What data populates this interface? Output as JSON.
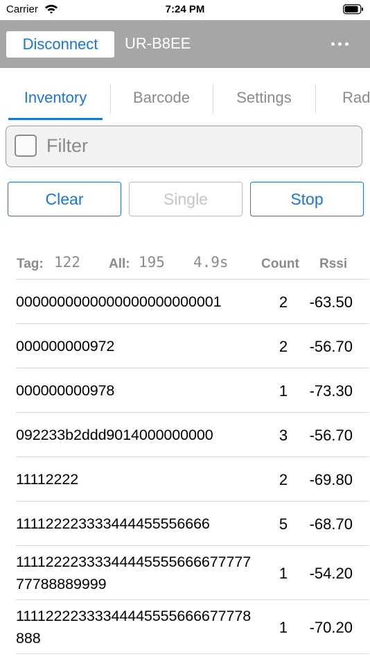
{
  "status_bar": {
    "carrier": "Carrier",
    "time": "7:24 PM"
  },
  "header": {
    "disconnect_label": "Disconnect",
    "device_name": "UR-B8EE",
    "more_icon": "ellipsis-icon"
  },
  "tabs": [
    {
      "label": "Inventory",
      "active": true
    },
    {
      "label": "Barcode",
      "active": false
    },
    {
      "label": "Settings",
      "active": false
    },
    {
      "label": "Rad",
      "active": false
    }
  ],
  "filter": {
    "label": "Filter",
    "checked": false
  },
  "actions": {
    "clear": "Clear",
    "single": "Single",
    "stop": "Stop"
  },
  "stats": {
    "tag_label": "Tag:",
    "tag_value": "122",
    "all_label": "All:",
    "all_value": "195",
    "time_value": "4.9s",
    "count_header": "Count",
    "rssi_header": "Rssi"
  },
  "rows": [
    {
      "epc": "0000000000000000000000001",
      "count": "2",
      "rssi": "-63.50"
    },
    {
      "epc": "000000000972",
      "count": "2",
      "rssi": "-56.70"
    },
    {
      "epc": "000000000978",
      "count": "1",
      "rssi": "-73.30"
    },
    {
      "epc": "092233b2ddd9014000000000",
      "count": "3",
      "rssi": "-56.70"
    },
    {
      "epc": "11112222",
      "count": "2",
      "rssi": "-69.80"
    },
    {
      "epc": "111122223333444455556666",
      "count": "5",
      "rssi": "-68.70"
    },
    {
      "epc": "1111222233334444555566667777777788889999",
      "count": "1",
      "rssi": "-54.20"
    },
    {
      "epc": "11112222333344445555666677778888",
      "count": "1",
      "rssi": "-70.20"
    }
  ]
}
